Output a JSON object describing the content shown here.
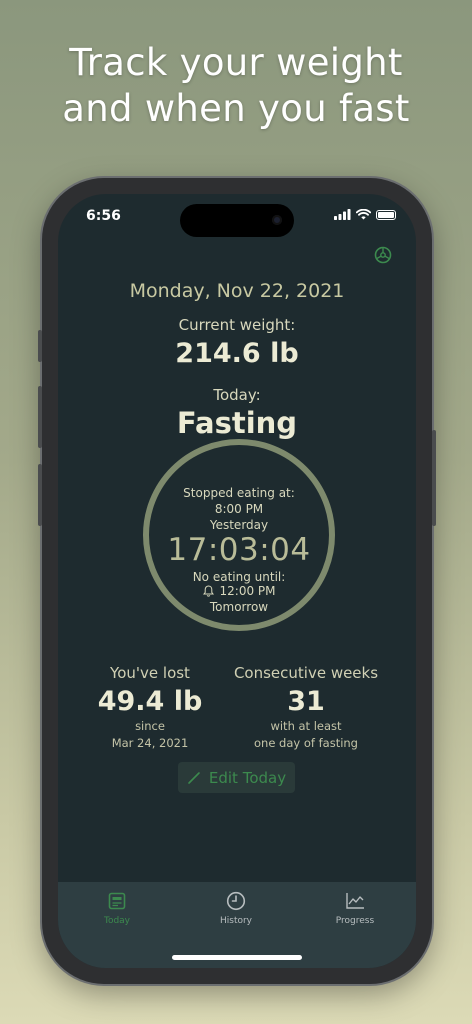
{
  "headline": {
    "line1": "Track your weight",
    "line2": "and when you fast"
  },
  "status_bar": {
    "time": "6:56"
  },
  "main": {
    "date": "Monday, Nov 22, 2021",
    "current_weight_label": "Current weight:",
    "current_weight_value": "214.6 lb",
    "today_label": "Today:",
    "today_status": "Fasting"
  },
  "ring": {
    "progress": 0.62,
    "stopped_label": "Stopped eating at:",
    "stopped_time": "8:00 PM",
    "stopped_day": "Yesterday",
    "timer": "17:03:04",
    "no_eating_label": "No eating until:",
    "no_eating_time": "12:00 PM",
    "no_eating_day": "Tomorrow"
  },
  "stats": {
    "lost_label": "You've lost",
    "lost_value": "49.4 lb",
    "lost_since_label": "since",
    "lost_since_date": "Mar 24, 2021",
    "weeks_label": "Consecutive weeks",
    "weeks_value": "31",
    "weeks_sub1": "with at least",
    "weeks_sub2": "one day of fasting"
  },
  "edit_button": {
    "label": "Edit Today",
    "icon": "pencil-icon"
  },
  "tabs": [
    {
      "label": "Today",
      "icon": "calendar-page-icon",
      "active": true
    },
    {
      "label": "History",
      "icon": "clock-icon",
      "active": false
    },
    {
      "label": "Progress",
      "icon": "line-chart-icon",
      "active": false
    }
  ],
  "colors": {
    "accent": "#3c8a4e",
    "ring_track": "#7e8a6d",
    "ring_fill": "#e3e3c8",
    "screen_bg": "#1e2b2f"
  }
}
